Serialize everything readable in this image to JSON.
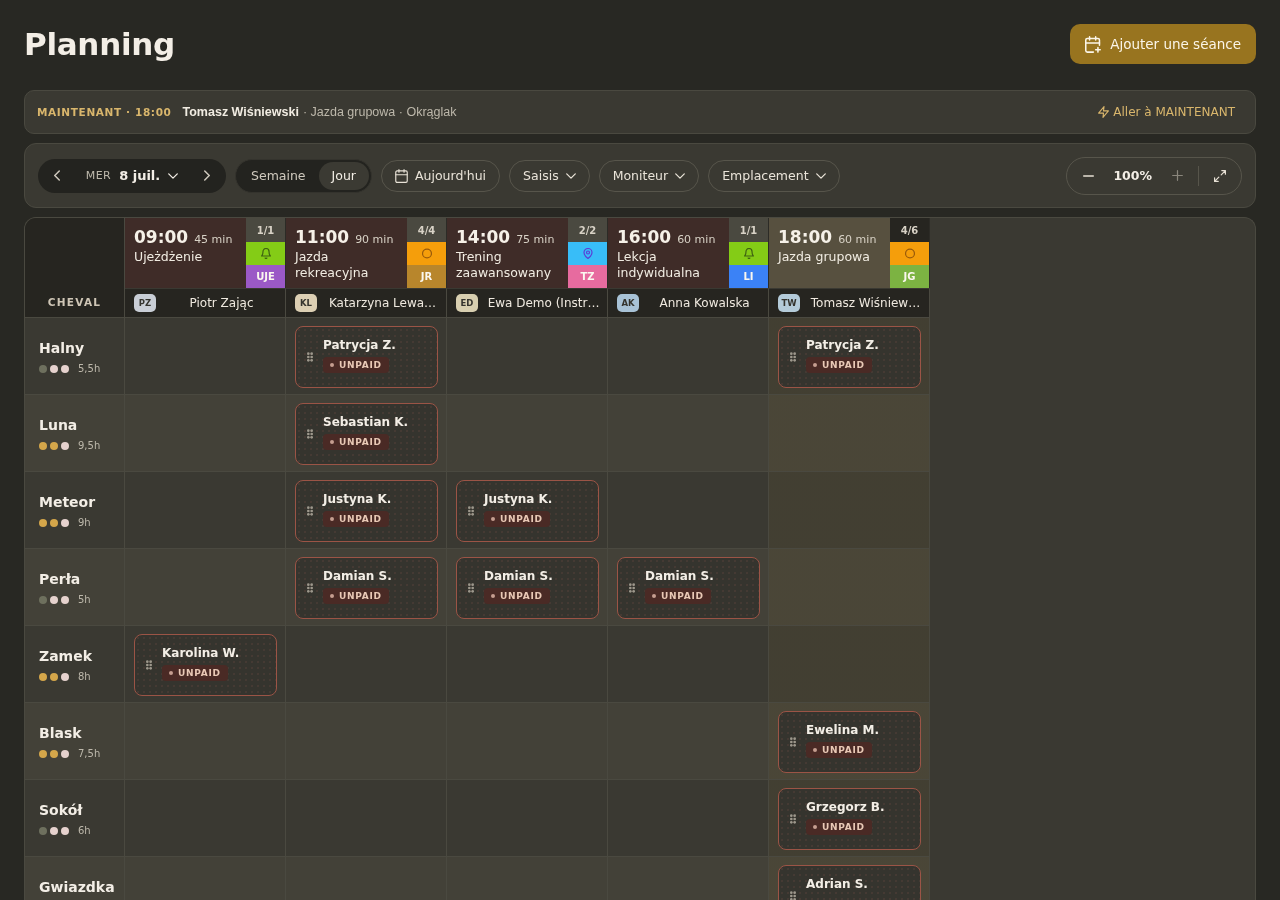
{
  "page": {
    "title": "Planning",
    "add_button": "Ajouter une séance"
  },
  "now_bar": {
    "label": "MAINTENANT · 18:00",
    "instructor": "Tomasz Wiśniewski",
    "details": "· Jazda grupowa · Okrąglak",
    "link": "Aller à MAINTENANT"
  },
  "toolbar": {
    "weekday": "MER",
    "date": "8 juil.",
    "views": [
      {
        "label": "Semaine",
        "selected": false
      },
      {
        "label": "Jour",
        "selected": true
      }
    ],
    "today_button": "Aujourd'hui",
    "filters": [
      "Saisis",
      "Moniteur",
      "Emplacement"
    ],
    "zoom": {
      "value": "100%",
      "zoom_in_disabled": true
    }
  },
  "grid": {
    "corner_label": "CHEVAL",
    "sessions": [
      {
        "time": "09:00",
        "duration": "45 min",
        "title": "Ujeżdżenie",
        "count": "1/1",
        "current": false,
        "marker": {
          "kind": "bell",
          "color": "#84cc16"
        },
        "code": {
          "text": "UJE",
          "color": "#9b59c6"
        },
        "instructor": {
          "initials": "PZ",
          "name": "Piotr Zając",
          "color": "#c9ced6"
        }
      },
      {
        "time": "11:00",
        "duration": "90 min",
        "title": "Jazda rekreacyjna",
        "count": "4/4",
        "current": false,
        "marker": {
          "kind": "ring",
          "color": "#f59e0b"
        },
        "code": {
          "text": "JR",
          "color": "#b8862c"
        },
        "instructor": {
          "initials": "KL",
          "name": "Katarzyna Lewa…",
          "color": "#dccfb3"
        }
      },
      {
        "time": "14:00",
        "duration": "75 min",
        "title": "Trening zaawansowany",
        "count": "2/2",
        "current": false,
        "marker": {
          "kind": "pin",
          "color": "#38bdf8"
        },
        "code": {
          "text": "TZ",
          "color": "#e76b9f"
        },
        "instructor": {
          "initials": "ED",
          "name": "Ewa Demo (Instr…",
          "color": "#d8cfb0"
        }
      },
      {
        "time": "16:00",
        "duration": "60 min",
        "title": "Lekcja indywidualna",
        "count": "1/1",
        "current": false,
        "marker": {
          "kind": "bell",
          "color": "#84cc16"
        },
        "code": {
          "text": "LI",
          "color": "#3b82f6"
        },
        "instructor": {
          "initials": "AK",
          "name": "Anna Kowalska",
          "color": "#a8c2d6"
        }
      },
      {
        "time": "18:00",
        "duration": "60 min",
        "title": "Jazda grupowa",
        "count": "4/6",
        "current": true,
        "marker": {
          "kind": "ring",
          "color": "#f59e0b"
        },
        "code": {
          "text": "JG",
          "color": "#7cb342"
        },
        "instructor": {
          "initials": "TW",
          "name": "Tomasz Wiśniew…",
          "color": "#b4cbd9"
        }
      }
    ],
    "horses": [
      {
        "name": "Halny",
        "dots": [
          {
            "color": "#6e705e"
          },
          {
            "color": "#e6d2ce"
          },
          {
            "color": "#e6d2ce"
          }
        ],
        "hours": "5,5h",
        "cells": [
          {
            "kind": "empty"
          },
          {
            "kind": "booking",
            "rider": "Patrycja Z.",
            "status": "UNPAID"
          },
          {
            "kind": "empty"
          },
          {
            "kind": "empty"
          },
          {
            "kind": "booking",
            "rider": "Patrycja Z.",
            "status": "UNPAID"
          }
        ]
      },
      {
        "name": "Luna",
        "dots": [
          {
            "color": "#d4a64a"
          },
          {
            "color": "#d4a64a"
          },
          {
            "color": "#e6d2ce"
          }
        ],
        "hours": "9,5h",
        "cells": [
          {
            "kind": "empty"
          },
          {
            "kind": "booking",
            "rider": "Sebastian K.",
            "status": "UNPAID"
          },
          {
            "kind": "empty"
          },
          {
            "kind": "empty"
          },
          {
            "kind": "empty"
          }
        ]
      },
      {
        "name": "Meteor",
        "dots": [
          {
            "color": "#d4a64a"
          },
          {
            "color": "#d4a64a"
          },
          {
            "color": "#e6d2ce"
          }
        ],
        "hours": "9h",
        "cells": [
          {
            "kind": "empty"
          },
          {
            "kind": "booking",
            "rider": "Justyna K.",
            "status": "UNPAID"
          },
          {
            "kind": "booking",
            "rider": "Justyna K.",
            "status": "UNPAID"
          },
          {
            "kind": "empty"
          },
          {
            "kind": "empty"
          }
        ]
      },
      {
        "name": "Perła",
        "dots": [
          {
            "color": "#6e705e"
          },
          {
            "color": "#e6d2ce"
          },
          {
            "color": "#e6d2ce"
          }
        ],
        "hours": "5h",
        "cells": [
          {
            "kind": "empty"
          },
          {
            "kind": "booking",
            "rider": "Damian S.",
            "status": "UNPAID"
          },
          {
            "kind": "booking",
            "rider": "Damian S.",
            "status": "UNPAID"
          },
          {
            "kind": "booking",
            "rider": "Damian S.",
            "status": "UNPAID"
          },
          {
            "kind": "empty"
          }
        ]
      },
      {
        "name": "Zamek",
        "dots": [
          {
            "color": "#d4a64a"
          },
          {
            "color": "#d4a64a"
          },
          {
            "color": "#e6d2ce"
          }
        ],
        "hours": "8h",
        "cells": [
          {
            "kind": "booking",
            "rider": "Karolina W.",
            "status": "UNPAID"
          },
          {
            "kind": "empty"
          },
          {
            "kind": "empty"
          },
          {
            "kind": "empty"
          },
          {
            "kind": "empty"
          }
        ]
      },
      {
        "name": "Blask",
        "dots": [
          {
            "color": "#d4a64a"
          },
          {
            "color": "#d4a64a"
          },
          {
            "color": "#e6d2ce"
          }
        ],
        "hours": "7,5h",
        "cells": [
          {
            "kind": "empty"
          },
          {
            "kind": "empty"
          },
          {
            "kind": "empty"
          },
          {
            "kind": "empty"
          },
          {
            "kind": "booking",
            "rider": "Ewelina M.",
            "status": "UNPAID"
          }
        ]
      },
      {
        "name": "Sokół",
        "dots": [
          {
            "color": "#6e705e"
          },
          {
            "color": "#e6d2ce"
          },
          {
            "color": "#e6d2ce"
          }
        ],
        "hours": "6h",
        "cells": [
          {
            "kind": "empty"
          },
          {
            "kind": "empty"
          },
          {
            "kind": "empty"
          },
          {
            "kind": "empty"
          },
          {
            "kind": "booking",
            "rider": "Grzegorz B.",
            "status": "UNPAID"
          }
        ]
      },
      {
        "name": "Gwiazdka",
        "cells": [
          {
            "kind": "empty"
          },
          {
            "kind": "empty"
          },
          {
            "kind": "empty"
          },
          {
            "kind": "empty"
          },
          {
            "kind": "booking",
            "rider": "Adrian S."
          }
        ]
      }
    ]
  }
}
